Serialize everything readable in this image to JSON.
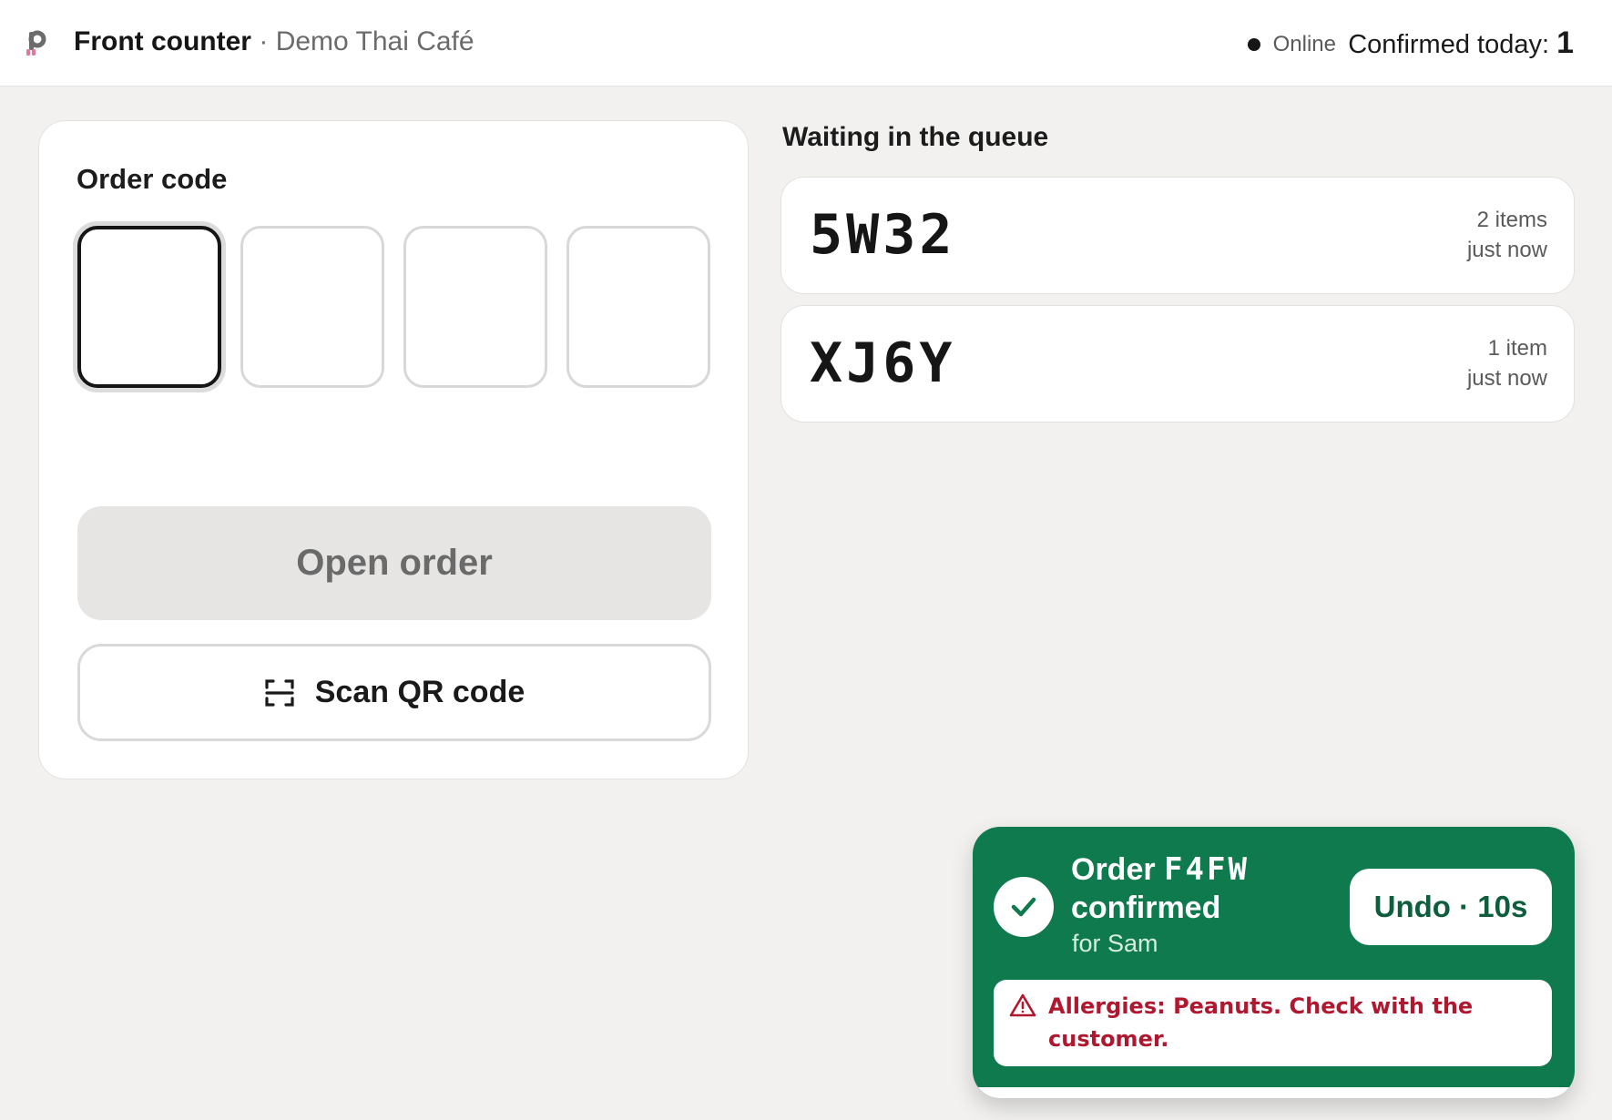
{
  "header": {
    "title": "Front counter",
    "separator": "·",
    "location": "Demo Thai Café",
    "status": "Online",
    "confirmed_label": "Confirmed today:",
    "confirmed_count": "1"
  },
  "order_panel": {
    "label": "Order code",
    "code_slots": [
      "",
      "",
      "",
      ""
    ],
    "open_button": "Open order",
    "scan_button": "Scan QR code"
  },
  "queue": {
    "heading": "Waiting in the queue",
    "items": [
      {
        "code": "5W32",
        "count": "2 items",
        "time": "just now"
      },
      {
        "code": "XJ6Y",
        "count": "1 item",
        "time": "just now"
      }
    ]
  },
  "toast": {
    "title_prefix": "Order",
    "order_code": "F4FW",
    "title_suffix": "confirmed",
    "subtitle": "for Sam",
    "undo_label": "Undo · 10s",
    "allergy_text": "Allergies: Peanuts. Check with the customer."
  },
  "colors": {
    "toast_bg": "#0f7a4d",
    "allergy_text": "#b0182f",
    "page_bg": "#f2f1ef"
  }
}
